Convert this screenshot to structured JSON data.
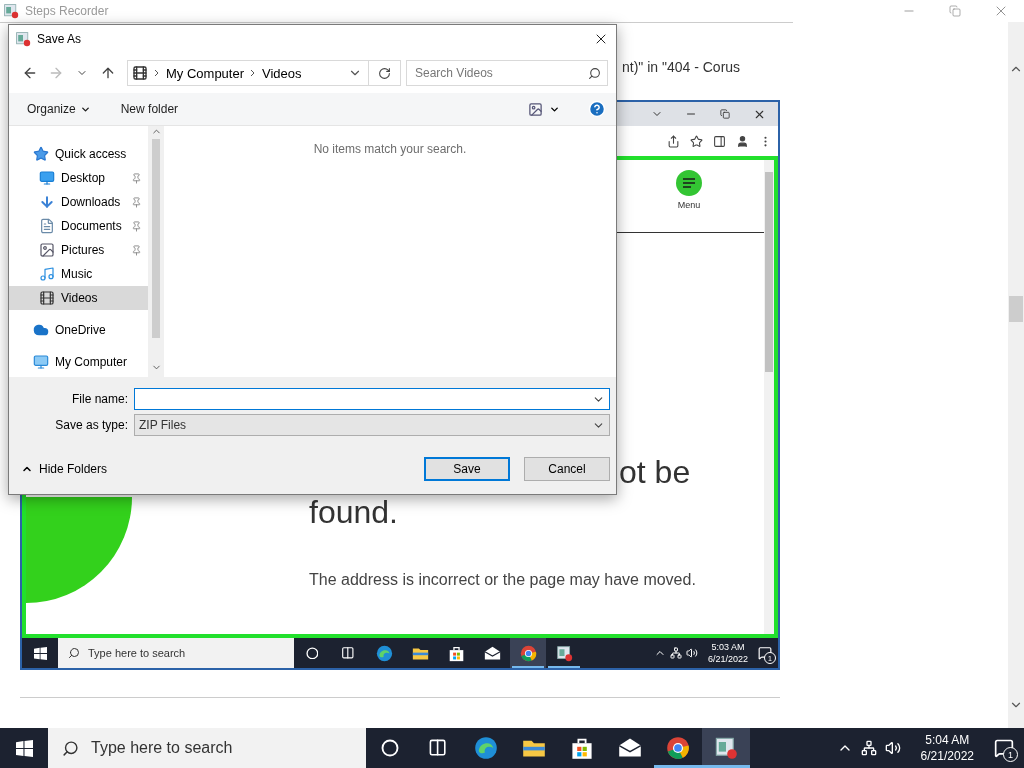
{
  "steps_window": {
    "title": "Steps Recorder",
    "step_text": "nt)\" in \"404 - Corus"
  },
  "screenshot": {
    "menu_label": "Menu",
    "heading_lines": [
      "ot be",
      "found."
    ],
    "message": "The address is incorrect or the page may have moved.",
    "taskbar": {
      "search_placeholder": "Type here to search",
      "time": "5:03 AM",
      "date": "6/21/2022",
      "notifications": "1",
      "apps": [
        {
          "kind": "cortana",
          "running": false,
          "active": false
        },
        {
          "kind": "taskview",
          "running": false,
          "active": false
        },
        {
          "kind": "edge",
          "running": false,
          "active": false
        },
        {
          "kind": "explorer",
          "running": false,
          "active": false
        },
        {
          "kind": "store",
          "running": false,
          "active": false
        },
        {
          "kind": "mail",
          "running": false,
          "active": false
        },
        {
          "kind": "chrome",
          "running": true,
          "active": true
        },
        {
          "kind": "steps",
          "running": true,
          "active": false
        }
      ]
    }
  },
  "dialog": {
    "title": "Save As",
    "nav_buttons": [
      {
        "kind": "back",
        "disabled": false
      },
      {
        "kind": "forward",
        "disabled": true
      },
      {
        "kind": "recent",
        "disabled": false
      },
      {
        "kind": "up",
        "disabled": false
      }
    ],
    "address": [
      "My Computer",
      "Videos"
    ],
    "search_placeholder": "Search Videos",
    "toolbar": {
      "organize": "Organize",
      "new_folder": "New folder"
    },
    "nav": [
      {
        "label": "Quick access",
        "kind": "quick",
        "selected": false,
        "children": [
          {
            "label": "Desktop",
            "kind": "desktop",
            "selected": false,
            "pinned": true
          },
          {
            "label": "Downloads",
            "kind": "downloads",
            "selected": false,
            "pinned": true
          },
          {
            "label": "Documents",
            "kind": "documents",
            "selected": false,
            "pinned": true
          },
          {
            "label": "Pictures",
            "kind": "pictures",
            "selected": false,
            "pinned": true
          },
          {
            "label": "Music",
            "kind": "music",
            "selected": false,
            "pinned": false
          },
          {
            "label": "Videos",
            "kind": "videos",
            "selected": true,
            "pinned": false
          }
        ]
      },
      {
        "label": "OneDrive",
        "kind": "cloud",
        "selected": false
      },
      {
        "label": "My Computer",
        "kind": "computer",
        "selected": false
      }
    ],
    "empty_message": "No items match your search.",
    "file_name": {
      "label": "File name:",
      "focused": true
    },
    "save_type": {
      "label": "Save as type:",
      "value": "ZIP Files"
    },
    "hide_folders": "Hide Folders",
    "buttons": [
      {
        "label": "Save",
        "kind": "primary"
      },
      {
        "label": "Cancel",
        "kind": "secondary"
      }
    ]
  },
  "taskbar": {
    "search_placeholder": "Type here to search",
    "time": "5:04 AM",
    "date": "6/21/2022",
    "notifications": "1",
    "apps": [
      {
        "kind": "cortana",
        "running": false,
        "active": false
      },
      {
        "kind": "taskview",
        "running": false,
        "active": false
      },
      {
        "kind": "edge",
        "running": false,
        "active": false
      },
      {
        "kind": "explorer",
        "running": false,
        "active": false
      },
      {
        "kind": "store",
        "running": false,
        "active": false
      },
      {
        "kind": "mail",
        "running": false,
        "active": false
      },
      {
        "kind": "chrome",
        "running": true,
        "active": false
      },
      {
        "kind": "steps",
        "running": true,
        "active": true
      }
    ]
  }
}
